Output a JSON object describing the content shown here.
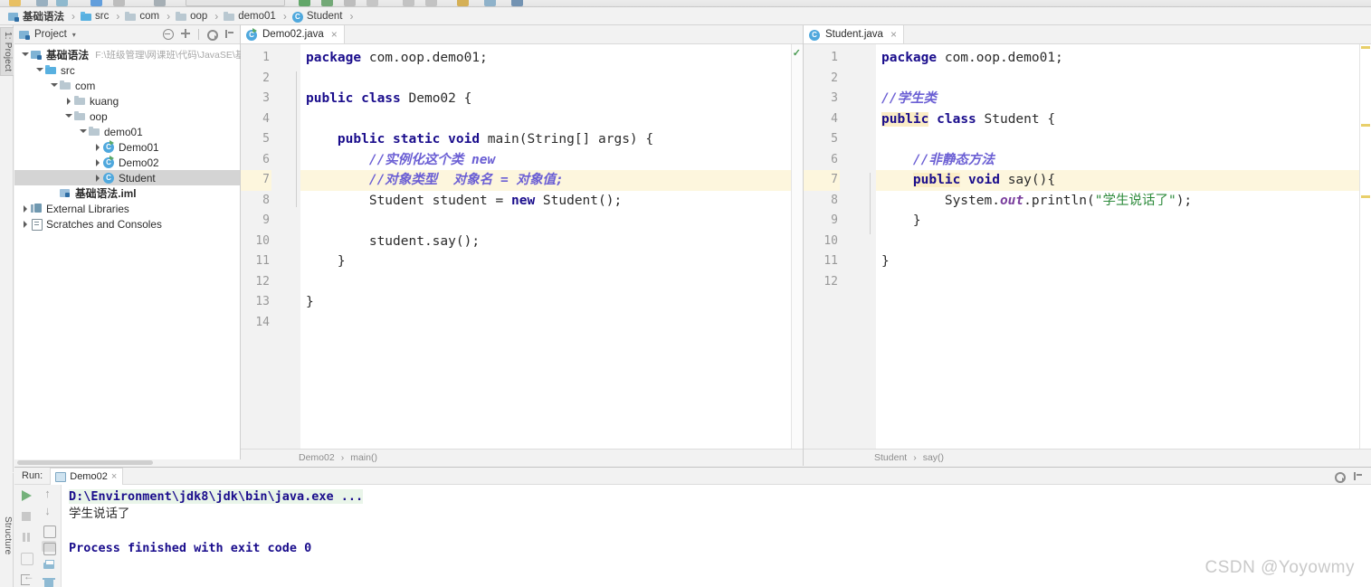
{
  "window": {
    "left_vertical_tab": "1: Project",
    "structure_tab": "Structure",
    "watermark": "CSDN @Yoyowmy"
  },
  "breadcrumb": {
    "items": [
      {
        "label": "基础语法",
        "icon": "module-icon",
        "bold": true
      },
      {
        "label": "src",
        "icon": "source-folder-icon",
        "bold": false
      },
      {
        "label": "com",
        "icon": "package-folder-icon",
        "bold": false
      },
      {
        "label": "oop",
        "icon": "package-folder-icon",
        "bold": false
      },
      {
        "label": "demo01",
        "icon": "package-folder-icon",
        "bold": false
      },
      {
        "label": "Student",
        "icon": "java-class-icon",
        "bold": false
      }
    ],
    "separator": "›"
  },
  "project_panel": {
    "title": "Project",
    "caret": "▾",
    "actions": [
      {
        "name": "collapse-all-icon"
      },
      {
        "name": "expand-all-icon"
      },
      {
        "name": "settings-gear-icon"
      },
      {
        "name": "hide-panel-icon"
      }
    ],
    "tree": [
      {
        "label": "基础语法",
        "path": "F:\\班级管理\\网课班\\代码\\JavaSE\\基础语",
        "indent": 0,
        "twist": "open",
        "icon": "module-icon",
        "bold": true,
        "selected": false
      },
      {
        "label": "src",
        "path": "",
        "indent": 1,
        "twist": "open",
        "icon": "source-folder-icon",
        "bold": false,
        "selected": false
      },
      {
        "label": "com",
        "path": "",
        "indent": 2,
        "twist": "open",
        "icon": "package-folder-icon",
        "bold": false,
        "selected": false
      },
      {
        "label": "kuang",
        "path": "",
        "indent": 3,
        "twist": "closed",
        "icon": "package-folder-icon",
        "bold": false,
        "selected": false
      },
      {
        "label": "oop",
        "path": "",
        "indent": 3,
        "twist": "open",
        "icon": "package-folder-icon",
        "bold": false,
        "selected": false
      },
      {
        "label": "demo01",
        "path": "",
        "indent": 4,
        "twist": "open",
        "icon": "package-folder-icon",
        "bold": false,
        "selected": false
      },
      {
        "label": "Demo01",
        "path": "",
        "indent": 5,
        "twist": "closed",
        "icon": "java-class-runnable-icon",
        "bold": false,
        "selected": false
      },
      {
        "label": "Demo02",
        "path": "",
        "indent": 5,
        "twist": "closed",
        "icon": "java-class-runnable-icon",
        "bold": false,
        "selected": false
      },
      {
        "label": "Student",
        "path": "",
        "indent": 5,
        "twist": "closed",
        "icon": "java-class-icon",
        "bold": false,
        "selected": true
      },
      {
        "label": "基础语法.iml",
        "path": "",
        "indent": 2,
        "twist": "none",
        "icon": "iml-file-icon",
        "bold": true,
        "selected": false
      },
      {
        "label": "External Libraries",
        "path": "",
        "indent": 0,
        "twist": "closed",
        "icon": "library-icon",
        "bold": false,
        "selected": false
      },
      {
        "label": "Scratches and Consoles",
        "path": "",
        "indent": 0,
        "twist": "closed",
        "icon": "scratches-icon",
        "bold": false,
        "selected": false
      }
    ]
  },
  "editor_left": {
    "tab": {
      "label": "Demo02.java",
      "icon": "java-class-runnable-icon",
      "close": "×"
    },
    "breadcrumb": [
      "Demo02",
      "main()"
    ],
    "breadcrumb_separator": "›",
    "highlighted_line": 7,
    "run_arrow_lines": [
      3,
      5
    ],
    "lines": [
      {
        "n": 1,
        "tokens": [
          {
            "t": "package ",
            "c": "kw"
          },
          {
            "t": "com.oop.demo01;",
            "c": "plain"
          }
        ]
      },
      {
        "n": 2,
        "tokens": []
      },
      {
        "n": 3,
        "tokens": [
          {
            "t": "public class ",
            "c": "kw"
          },
          {
            "t": "Demo02 {",
            "c": "plain"
          }
        ]
      },
      {
        "n": 4,
        "tokens": []
      },
      {
        "n": 5,
        "tokens": [
          {
            "t": "    ",
            "c": "plain"
          },
          {
            "t": "public static void ",
            "c": "kw"
          },
          {
            "t": "main(String[] args) {",
            "c": "plain"
          }
        ]
      },
      {
        "n": 6,
        "tokens": [
          {
            "t": "        //实例化这个类 new",
            "c": "cmt"
          }
        ]
      },
      {
        "n": 7,
        "tokens": [
          {
            "t": "        //对象类型  对象名 = 对象值;",
            "c": "cmt"
          }
        ]
      },
      {
        "n": 8,
        "tokens": [
          {
            "t": "        Student student = ",
            "c": "plain"
          },
          {
            "t": "new ",
            "c": "kw"
          },
          {
            "t": "Student();",
            "c": "plain"
          }
        ]
      },
      {
        "n": 9,
        "tokens": []
      },
      {
        "n": 10,
        "tokens": [
          {
            "t": "        student.say();",
            "c": "plain"
          }
        ]
      },
      {
        "n": 11,
        "tokens": [
          {
            "t": "    }",
            "c": "plain"
          }
        ]
      },
      {
        "n": 12,
        "tokens": []
      },
      {
        "n": 13,
        "tokens": [
          {
            "t": "}",
            "c": "plain"
          }
        ]
      },
      {
        "n": 14,
        "tokens": []
      }
    ]
  },
  "editor_right": {
    "tab": {
      "label": "Student.java",
      "icon": "java-class-icon",
      "close": "×"
    },
    "breadcrumb": [
      "Student",
      "say()"
    ],
    "breadcrumb_separator": "›",
    "highlighted_line": 7,
    "lines": [
      {
        "n": 1,
        "tokens": [
          {
            "t": "package ",
            "c": "kw"
          },
          {
            "t": "com.oop.demo01;",
            "c": "plain"
          }
        ]
      },
      {
        "n": 2,
        "tokens": []
      },
      {
        "n": 3,
        "tokens": [
          {
            "t": "//学生类",
            "c": "cmt"
          }
        ]
      },
      {
        "n": 4,
        "tokens": [
          {
            "t": "public",
            "c": "kwhl"
          },
          {
            "t": " ",
            "c": "plain"
          },
          {
            "t": "class",
            "c": "kw"
          },
          {
            "t": " Student {",
            "c": "plain"
          }
        ]
      },
      {
        "n": 5,
        "tokens": []
      },
      {
        "n": 6,
        "tokens": [
          {
            "t": "    //非静态方法",
            "c": "cmt"
          }
        ]
      },
      {
        "n": 7,
        "tokens": [
          {
            "t": "    ",
            "c": "plain"
          },
          {
            "t": "public",
            "c": "kwhl"
          },
          {
            "t": " ",
            "c": "plain"
          },
          {
            "t": "void",
            "c": "kw"
          },
          {
            "t": " say(){",
            "c": "plain"
          }
        ]
      },
      {
        "n": 8,
        "tokens": [
          {
            "t": "        System.",
            "c": "plain"
          },
          {
            "t": "out",
            "c": "fld"
          },
          {
            "t": ".println(",
            "c": "plain"
          },
          {
            "t": "\"学生说话了\"",
            "c": "str"
          },
          {
            "t": ");",
            "c": "plain"
          }
        ]
      },
      {
        "n": 9,
        "tokens": [
          {
            "t": "    }",
            "c": "plain"
          }
        ]
      },
      {
        "n": 10,
        "tokens": []
      },
      {
        "n": 11,
        "tokens": [
          {
            "t": "}",
            "c": "plain"
          }
        ]
      },
      {
        "n": 12,
        "tokens": []
      }
    ]
  },
  "run_panel": {
    "label": "Run:",
    "tab": {
      "label": "Demo02",
      "icon": "run-config-icon",
      "close": "×"
    },
    "settings_icon": "gear-icon",
    "hide_icon": "minimize-icon",
    "toolbar": [
      {
        "name": "rerun-button",
        "glyph": "play"
      },
      {
        "name": "stop-button",
        "glyph": "stop"
      },
      {
        "name": "pause-button",
        "glyph": "pause"
      },
      {
        "name": "dump-threads-button",
        "glyph": "dump"
      },
      {
        "name": "exit-button",
        "glyph": "exit"
      },
      {
        "name": "scroll-up-button",
        "glyph": "arrow-up"
      },
      {
        "name": "scroll-down-button",
        "glyph": "arrow-dn"
      },
      {
        "name": "soft-wrap-button",
        "glyph": "sqbox"
      },
      {
        "name": "scroll-to-end-button",
        "glyph": "sqbox-selected"
      },
      {
        "name": "print-button",
        "glyph": "printer"
      },
      {
        "name": "clear-all-button",
        "glyph": "trash"
      }
    ],
    "output": [
      {
        "text": "D:\\Environment\\jdk8\\jdk\\bin\\java.exe ...",
        "style": "cmdline"
      },
      {
        "text": "学生说话了",
        "style": "outtext"
      },
      {
        "text": "",
        "style": "outtext"
      },
      {
        "text": "Process finished with exit code 0",
        "style": "donetext"
      }
    ]
  },
  "colors": {
    "keyword": "#1a0d8c",
    "comment": "#6b5fd4",
    "string": "#2e8b3c",
    "field": "#7a3f9d",
    "highlight_line": "#fdf6dd",
    "keyword_highlight": "#fbedc5",
    "run_green": "#4a9b52",
    "selection": "#d4d4d4"
  }
}
